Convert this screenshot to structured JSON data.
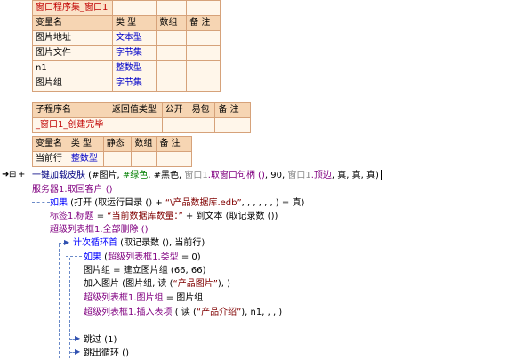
{
  "window_table": {
    "title": "窗口程序集_窗口1",
    "headers": [
      "变量名",
      "类 型",
      "数组",
      "备 注"
    ],
    "rows": [
      [
        "图片地址",
        "文本型",
        "",
        ""
      ],
      [
        "图片文件",
        "字节集",
        "",
        ""
      ],
      [
        "n1",
        "整数型",
        "",
        ""
      ],
      [
        "图片组",
        "字节集",
        "",
        ""
      ]
    ]
  },
  "sub_table": {
    "headers": [
      "子程序名",
      "返回值类型",
      "公开",
      "易包",
      "备 注"
    ],
    "name": "_窗口1_创建完毕"
  },
  "local_table": {
    "headers": [
      "变量名",
      "类 型",
      "静态",
      "数组",
      "备 注"
    ],
    "rows": [
      [
        "当前行",
        "整数型",
        "",
        "",
        ""
      ]
    ]
  },
  "code": {
    "line1": {
      "cmd": "一键加载皮肤",
      "open": " (#图片, ",
      "c1": "#绿色",
      "sep1": ", ",
      "c2": "#黑色",
      "sep2": ", ",
      "obj1": "窗口1",
      "prop1": ".取窗口句柄 ()",
      "args": ", 90, ",
      "obj2": "窗口1",
      "prop2": ".顶边",
      "tail": ", 真, 真, 真)"
    },
    "line2": "服务器1.取回客户 ()",
    "line3": {
      "kw": "如果",
      "open": " (打开 (取运行目录 () + ",
      "str": "“\\产品数据库.edb”",
      "tail": ", , , , , , ) = 真)"
    },
    "line4": {
      "obj": "标签1.标题",
      "eq": " = ",
      "str": "“当前数据库数量：”",
      "tail": " + 到文本 (取记录数 ())"
    },
    "line5": "超级列表框1.全部删除 ()",
    "line6": {
      "kw": "计次循环首",
      "tail": " (取记录数 (), 当前行)"
    },
    "line7": {
      "kw": "如果",
      "open": " (",
      "obj": "超级列表框1.类型",
      "tail": " = 0)"
    },
    "line8": "图片组 = 建立图片组 (66, 66)",
    "line9": {
      "head": "加入图片 (图片组, 读 (",
      "str": "“产品图片”",
      "tail": "), )"
    },
    "line10": {
      "obj": "超级列表框1.图片组",
      "tail": " = 图片组"
    },
    "line11": {
      "obj": "超级列表框1.插入表项",
      "open": " ( 读 (",
      "str": "“产品介绍”",
      "tail": "), n1, , , )"
    },
    "line12": "跳过 (1)",
    "line13": "跳出循环 ()"
  },
  "margin": {
    "arrow_glyph": "➜",
    "marker": "⊟",
    "plus": "+"
  },
  "colors": {
    "table_border": "#d6a27a",
    "header_bg": "#f6d5b3",
    "row_bg": "#fff6ea",
    "type_blue": "#0000c8",
    "name_red": "#c00000"
  }
}
